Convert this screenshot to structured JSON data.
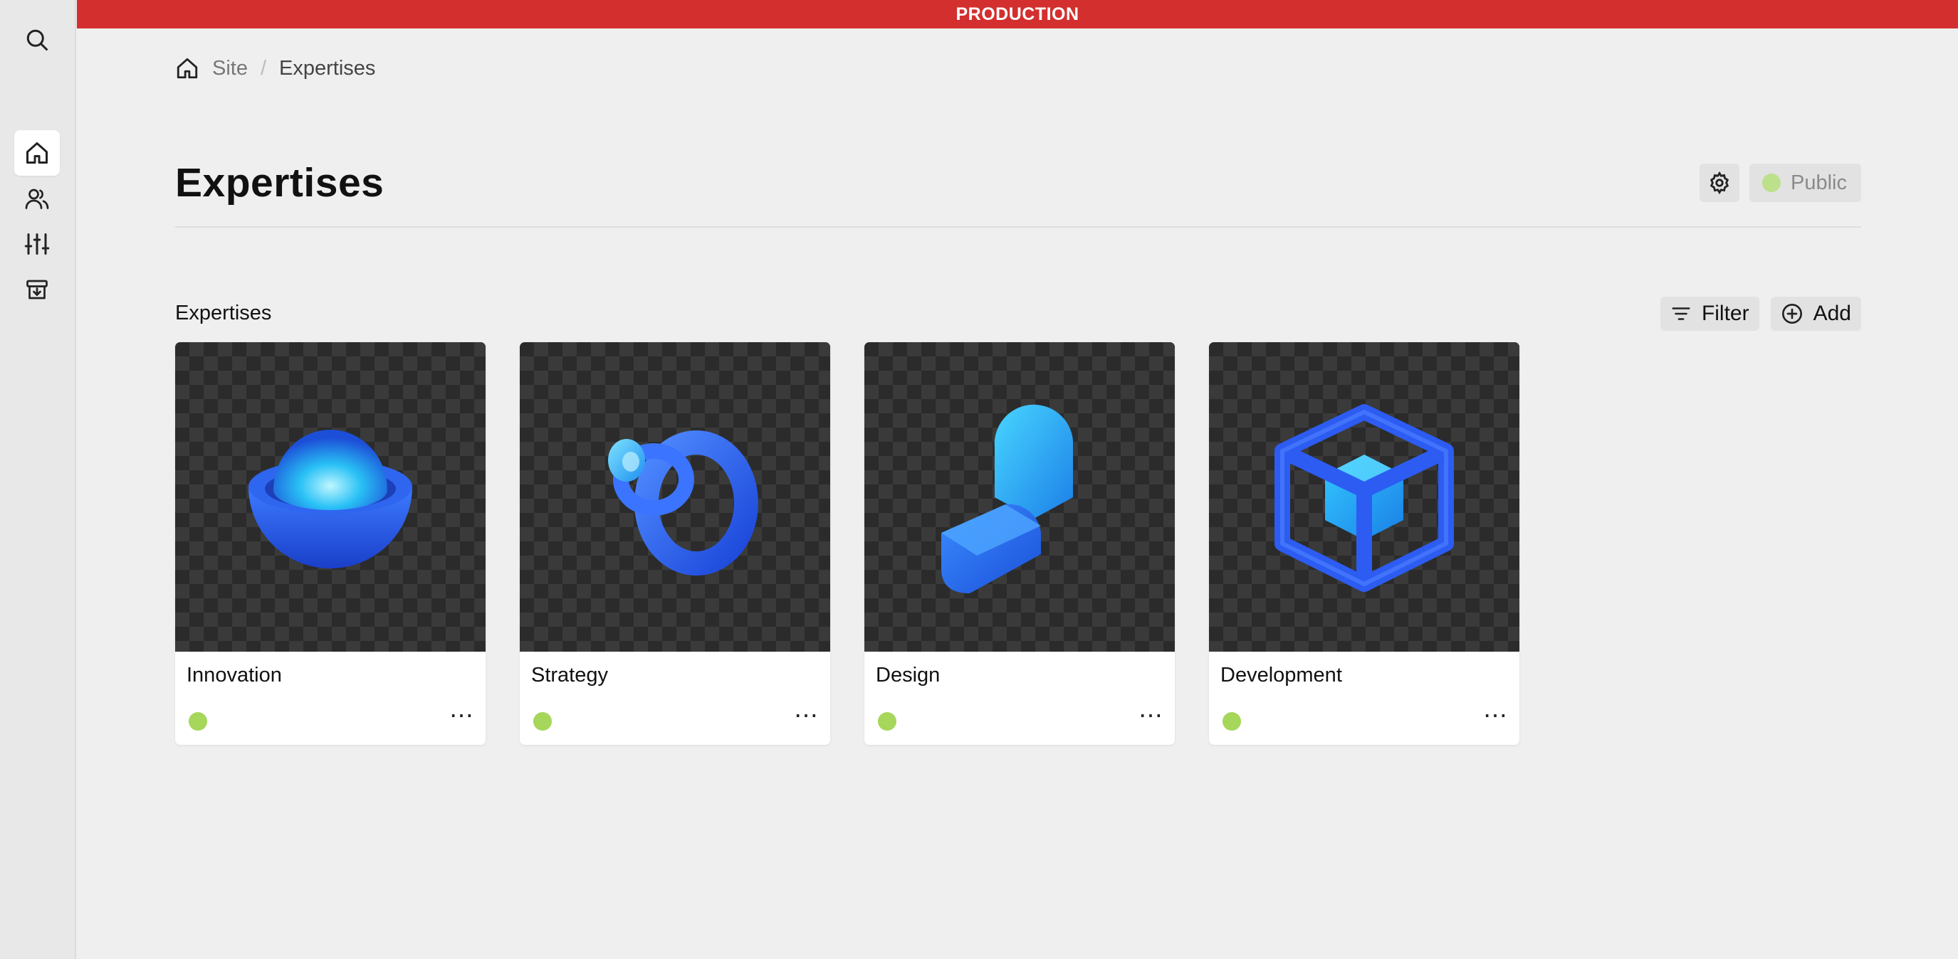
{
  "environment_banner": "PRODUCTION",
  "sidebar": {
    "items": [
      {
        "name": "search",
        "icon": "search-icon"
      },
      {
        "name": "home",
        "icon": "home-icon",
        "active": true
      },
      {
        "name": "users",
        "icon": "users-icon"
      },
      {
        "name": "settings",
        "icon": "sliders-icon"
      },
      {
        "name": "archive",
        "icon": "archive-icon"
      }
    ]
  },
  "breadcrumb": {
    "home_icon": "home-icon",
    "items": [
      "Site",
      "Expertises"
    ]
  },
  "page": {
    "title": "Expertises",
    "visibility_label": "Public",
    "settings_icon": "gear-icon"
  },
  "section": {
    "title": "Expertises",
    "filter_label": "Filter",
    "add_label": "Add"
  },
  "cards": [
    {
      "name": "Innovation",
      "status_color": "#a6d65a",
      "more": "⋯"
    },
    {
      "name": "Strategy",
      "status_color": "#a6d65a",
      "more": "⋯"
    },
    {
      "name": "Design",
      "status_color": "#a6d65a",
      "more": "⋯"
    },
    {
      "name": "Development",
      "status_color": "#a6d65a",
      "more": "⋯"
    }
  ],
  "colors": {
    "banner": "#d32f2f",
    "accent_blue": "#2f6bff",
    "status_green": "#a6d65a"
  }
}
